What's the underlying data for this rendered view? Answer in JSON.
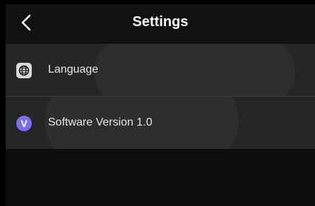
{
  "header": {
    "title": "Settings",
    "back_icon": "chevron-left-icon"
  },
  "items": [
    {
      "label": "Language",
      "icon": "globe-icon"
    },
    {
      "label": "Software Version 1.0",
      "icon": "version-v-icon",
      "icon_text": "V",
      "icon_color": "#7b6cf0"
    }
  ]
}
